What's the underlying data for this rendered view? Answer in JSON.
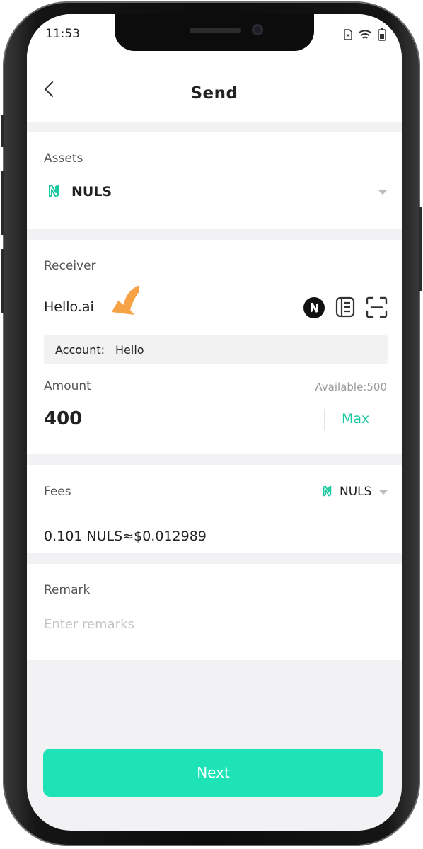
{
  "status_bar": {
    "time": "11:53"
  },
  "header": {
    "title": "Send"
  },
  "assets": {
    "label": "Assets",
    "selected": "NULS"
  },
  "receiver": {
    "label": "Receiver",
    "value": "Hello.ai",
    "account_prefix": "Account:",
    "account_name": "Hello"
  },
  "amount": {
    "label": "Amount",
    "available": "Available:500",
    "value": "400",
    "max_label": "Max"
  },
  "fees": {
    "label": "Fees",
    "currency": "NULS",
    "value": "0.101 NULS≈$0.012989"
  },
  "remark": {
    "label": "Remark",
    "placeholder": "Enter remarks"
  },
  "actions": {
    "next_label": "Next"
  },
  "colors": {
    "accent": "#1ee3b6",
    "teal_text": "#18c9a0",
    "arrow": "#f7a245"
  }
}
